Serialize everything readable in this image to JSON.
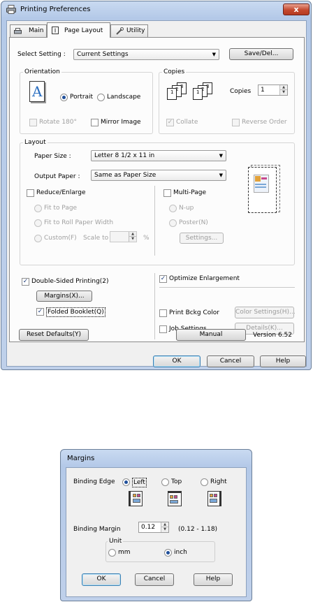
{
  "prefs": {
    "title": "Printing Preferences",
    "close_glyph": "x",
    "tabs": [
      "Main",
      "Page Layout",
      "Utility"
    ],
    "select_setting_label": "Select Setting :",
    "select_setting_value": "Current Settings",
    "save_del_label": "Save/Del...",
    "orientation": {
      "label": "Orientation",
      "preview_glyph": "A",
      "portrait": "Portrait",
      "landscape": "Landscape",
      "rotate180": "Rotate 180°",
      "mirror": "Mirror Image"
    },
    "copies": {
      "label": "Copies",
      "copies_label": "Copies",
      "value": "1",
      "collate": "Collate",
      "reverse_order": "Reverse Order",
      "page_nums": [
        "1",
        "2",
        "3"
      ]
    },
    "layout": {
      "label": "Layout",
      "paper_size_label": "Paper Size :",
      "paper_size_value": "Letter 8 1/2 x 11 in",
      "output_paper_label": "Output Paper :",
      "output_paper_value": "Same as Paper Size",
      "reduce_enlarge": "Reduce/Enlarge",
      "fit_to_page": "Fit to Page",
      "fit_roll": "Fit to Roll Paper Width",
      "custom": "Custom(F)",
      "scale_to": "Scale to",
      "percent": "%",
      "multi_page": "Multi-Page",
      "n_up": "N-up",
      "poster": "Poster(N)",
      "settings": "Settings..."
    },
    "double_sided": "Double-Sided Printing(2)",
    "margins_btn": "Margins(X)...",
    "folded_booklet": "Folded Booklet(Q)",
    "optimize": "Optimize Enlargement",
    "print_bckg": "Print Bckg Color",
    "color_settings": "Color Settings(H)...",
    "job_settings": "Job Settings",
    "details": "Details(K)...",
    "reset_defaults": "Reset Defaults(Y)",
    "manual": "Manual",
    "version": "Version 6.52",
    "ok": "OK",
    "cancel": "Cancel",
    "help": "Help"
  },
  "margins": {
    "title": "Margins",
    "binding_edge_label": "Binding Edge",
    "left": "Left",
    "top": "Top",
    "right": "Right",
    "binding_margin_label": "Binding Margin",
    "value": "0.12",
    "range": "(0.12 - 1.18)",
    "unit_label": "Unit",
    "mm": "mm",
    "inch": "inch",
    "ok": "OK",
    "cancel": "Cancel",
    "help": "Help"
  },
  "colors": {
    "title_bar": "#bfd0ea",
    "dialog_face": "#f0f0f0",
    "tab_face": "#fcfcfc",
    "check_mark": "#1e3d7a",
    "radio_dot": "#1f4f9a",
    "close_button": "#c4492f"
  },
  "icons": {
    "printer": "printer-icon",
    "page_setup": "page-setup-icon",
    "utility": "wrench-icon",
    "close": "close-icon"
  }
}
